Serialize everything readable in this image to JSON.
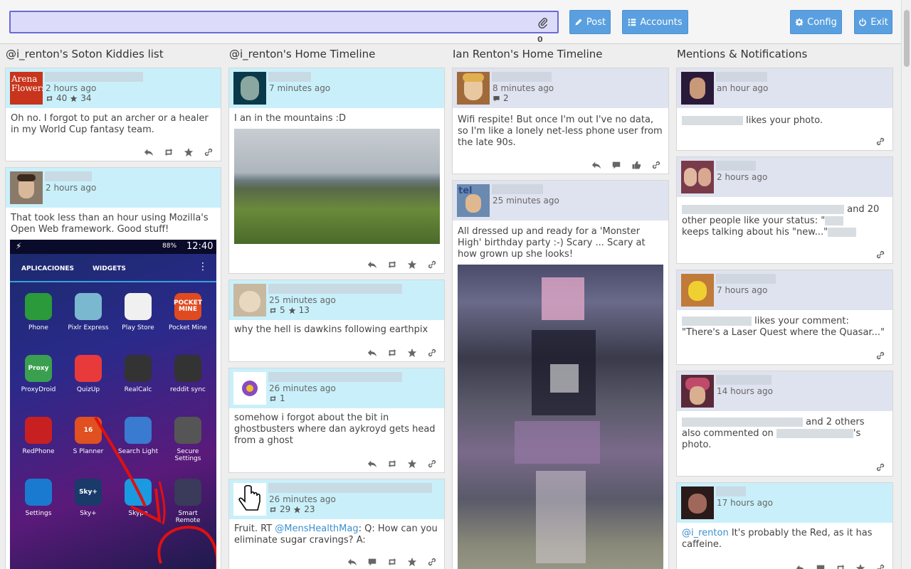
{
  "toolbar": {
    "post_value": "",
    "char_count": "0",
    "post_label": "Post",
    "accounts_label": "Accounts",
    "config_label": "Config",
    "exit_label": "Exit"
  },
  "columns": [
    {
      "title": "@i_renton's Soton Kiddies list",
      "cards": [
        {
          "time": "2 hours ago",
          "retweets": "40",
          "favorites": "34",
          "text": "Oh no. I forgot to put an archer or a healer in my World Cup fantasy team.",
          "avatar_text": "Arena Flowers"
        },
        {
          "time": "2 hours ago",
          "text": "That took less than an hour using Mozilla's Open Web framework. Good stuff!"
        }
      ],
      "phone": {
        "clock": "12:40",
        "battery": "88%",
        "tabs": [
          "APLICACIONES",
          "WIDGETS"
        ],
        "apps": [
          "Phone",
          "Pixlr Express",
          "Play Store",
          "Pocket Mine",
          "ProxyDroid",
          "QuizUp",
          "RealCalc",
          "reddit sync",
          "RedPhone",
          "S Planner",
          "Search Light",
          "Secure Settings",
          "Settings",
          "Sky+",
          "Skype",
          "Smart Remote"
        ],
        "icon_labels": [
          "Proxy",
          "16",
          "Sky+",
          "POCKET MINE"
        ]
      }
    },
    {
      "title": "@i_renton's Home Timeline",
      "cards": [
        {
          "time": "7 minutes ago",
          "text": "I an in the mountains :D"
        },
        {
          "time": "25 minutes ago",
          "retweets": "5",
          "favorites": "13",
          "text": "why the hell is dawkins following earthpix"
        },
        {
          "time": "26 minutes ago",
          "retweets": "1",
          "text": "somehow i forgot about the bit in ghostbusters where dan aykroyd gets head from a ghost"
        },
        {
          "time": "26 minutes ago",
          "retweets": "29",
          "favorites": "23",
          "text_before": "Fruit. RT ",
          "mention": "@MensHealthMag",
          "text_after": ": Q: How can you eliminate sugar cravings? A:"
        }
      ]
    },
    {
      "title": "Ian Renton's Home Timeline",
      "cards": [
        {
          "time": "8 minutes ago",
          "comments": "2",
          "text": "Wifi respite! But once I'm out I've no data, so I'm like a lonely net-less phone user from the late 90s."
        },
        {
          "time": "25 minutes ago",
          "text": "All dressed up and ready for a 'Monster High' birthday party :-) Scary ... Scary at how grown up she looks!"
        }
      ]
    },
    {
      "title": "Mentions & Notifications",
      "cards": [
        {
          "time": "an hour ago",
          "text": "likes your photo."
        },
        {
          "time": "2 hours ago",
          "text_a": "and 20",
          "text_b": "other people like your status: \"",
          "text_c": "keeps talking about his \"new...\""
        },
        {
          "time": "7 hours ago",
          "text_a": "likes your comment:",
          "text_b": "\"There's a Laser Quest where the Quasar...\""
        },
        {
          "time": "14 hours ago",
          "text_a": "and 2 others",
          "text_b": "also commented on",
          "text_c": "'s",
          "text_d": "photo."
        },
        {
          "time": "17 hours ago",
          "mention": "@i_renton",
          "text": " It's probably the Red, as it has caffeine."
        }
      ]
    }
  ],
  "icons": {
    "clip": "paperclip-icon",
    "post": "pencil-icon",
    "accounts": "list-icon",
    "config": "gear-icon",
    "exit": "power-icon",
    "retweet": "retweet-icon",
    "favorite": "star-icon",
    "reply": "reply-icon",
    "link": "link-icon",
    "comment": "comment-icon",
    "like": "thumbs-up-icon"
  },
  "colors": {
    "accent": "#5aa0e0",
    "card_header_twitter": "#c9f0fa",
    "card_header_facebook": "#dfe3ef",
    "input_bg": "#dcdcfa",
    "input_border": "#6a6ad8",
    "mention": "#3a8fd0"
  }
}
